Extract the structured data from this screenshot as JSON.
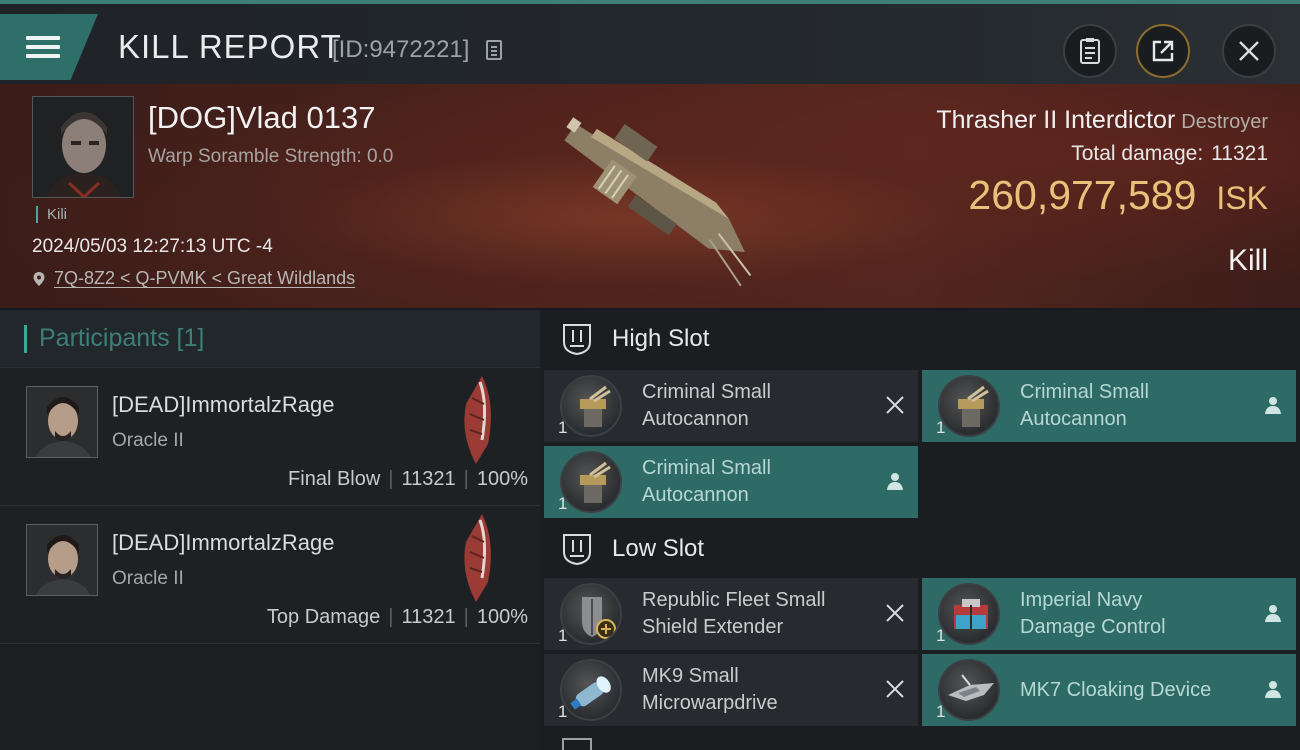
{
  "header": {
    "title": "KILL REPORT",
    "report_id": "[ID:9472221]"
  },
  "victim": {
    "name": "[DOG]Vlad 0137",
    "warp_scramble": "Warp Soramble Strength: 0.0",
    "tag": "Kili",
    "datetime": "2024/05/03 12:27:13 UTC -4",
    "location": "7Q-8Z2 < Q-PVMK < Great Wildlands",
    "ship": "Thrasher II Interdictor",
    "ship_class": "Destroyer",
    "total_damage_label": "Total damage:",
    "total_damage": "11321",
    "isk_value": "260,977,589",
    "isk_unit": "ISK",
    "result": "Kill"
  },
  "participants": {
    "label": "Participants [1]",
    "rows": [
      {
        "name": "[DEAD]ImmortalzRage",
        "ship": "Oracle II",
        "role": "Final Blow",
        "damage": "11321",
        "percent": "100%"
      },
      {
        "name": "[DEAD]ImmortalzRage",
        "ship": "Oracle II",
        "role": "Top Damage",
        "damage": "11321",
        "percent": "100%"
      }
    ]
  },
  "slots": {
    "high_label": "High Slot",
    "low_label": "Low Slot",
    "high": [
      {
        "line1": "Criminal Small",
        "line2": "Autocannon",
        "qty": "1",
        "state": "destroyed"
      },
      {
        "line1": "Criminal Small",
        "line2": "Autocannon",
        "qty": "1",
        "state": "dropped"
      },
      {
        "line1": "Criminal Small",
        "line2": "Autocannon",
        "qty": "1",
        "state": "dropped"
      }
    ],
    "low": [
      {
        "line1": "Republic Fleet Small",
        "line2": "Shield Extender",
        "qty": "1",
        "state": "destroyed"
      },
      {
        "line1": "Imperial Navy",
        "line2": "Damage Control",
        "qty": "1",
        "state": "dropped"
      },
      {
        "line1": "MK9 Small",
        "line2": "Microwarpdrive",
        "qty": "1",
        "state": "destroyed"
      },
      {
        "line1": "MK7 Cloaking Device",
        "line2": "",
        "qty": "1",
        "state": "dropped"
      }
    ]
  },
  "colors": {
    "accent_teal": "#2f6b66",
    "isk_gold": "#e8c27a",
    "header_red": "#4a221c"
  },
  "icons": [
    "menu-icon",
    "copy-icon",
    "notes-icon",
    "share-icon",
    "close-icon",
    "location-pin-icon",
    "slot-shield-icon",
    "destroyed-x-icon",
    "dropped-person-icon"
  ]
}
